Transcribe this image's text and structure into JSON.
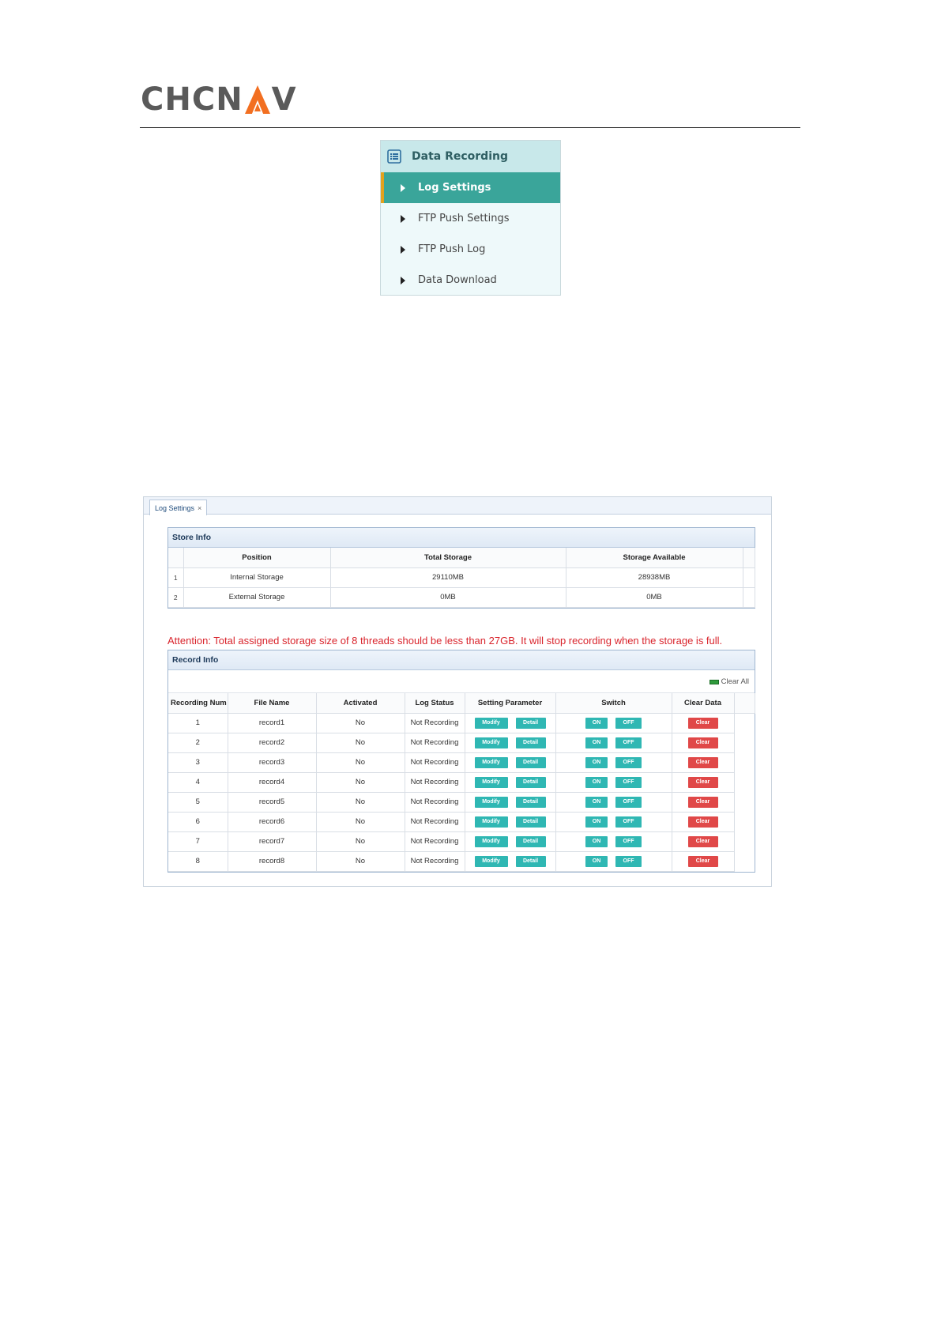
{
  "brand": {
    "logo_text_left": "CHCN",
    "logo_text_right": "V",
    "logo_accent": "#f26f21"
  },
  "nav": {
    "header": "Data Recording",
    "items": [
      {
        "label": "Log Settings",
        "active": true
      },
      {
        "label": "FTP Push Settings",
        "active": false
      },
      {
        "label": "FTP Push Log",
        "active": false
      },
      {
        "label": "Data Download",
        "active": false
      }
    ]
  },
  "tab": {
    "label": "Log Settings",
    "close": "×"
  },
  "store_info": {
    "title": "Store Info",
    "columns": [
      "Position",
      "Total Storage",
      "Storage Available"
    ],
    "rows": [
      {
        "idx": "1",
        "position": "Internal Storage",
        "total": "29110MB",
        "available": "28938MB"
      },
      {
        "idx": "2",
        "position": "External Storage",
        "total": "0MB",
        "available": "0MB"
      }
    ]
  },
  "attention": "Attention: Total assigned storage size of 8 threads should be less than 27GB. It will stop recording when the storage is full.",
  "record_info": {
    "title": "Record Info",
    "clear_all": "Clear All",
    "columns": [
      "Recording Num",
      "File Name",
      "Activated",
      "Log Status",
      "Setting Parameter",
      "Switch",
      "Clear Data"
    ],
    "buttons": {
      "modify": "Modify",
      "detail": "Detail",
      "on": "ON",
      "off": "OFF",
      "clear": "Clear"
    },
    "rows": [
      {
        "num": "1",
        "file": "record1",
        "activated": "No",
        "status": "Not Recording"
      },
      {
        "num": "2",
        "file": "record2",
        "activated": "No",
        "status": "Not Recording"
      },
      {
        "num": "3",
        "file": "record3",
        "activated": "No",
        "status": "Not Recording"
      },
      {
        "num": "4",
        "file": "record4",
        "activated": "No",
        "status": "Not Recording"
      },
      {
        "num": "5",
        "file": "record5",
        "activated": "No",
        "status": "Not Recording"
      },
      {
        "num": "6",
        "file": "record6",
        "activated": "No",
        "status": "Not Recording"
      },
      {
        "num": "7",
        "file": "record7",
        "activated": "No",
        "status": "Not Recording"
      },
      {
        "num": "8",
        "file": "record8",
        "activated": "No",
        "status": "Not Recording"
      }
    ]
  },
  "colors": {
    "nav_active": "#3aa59a",
    "nav_active_bar": "#e3a21e",
    "btn_teal": "#2fb7b3",
    "btn_red": "#e04848",
    "attention": "#d9242c"
  }
}
